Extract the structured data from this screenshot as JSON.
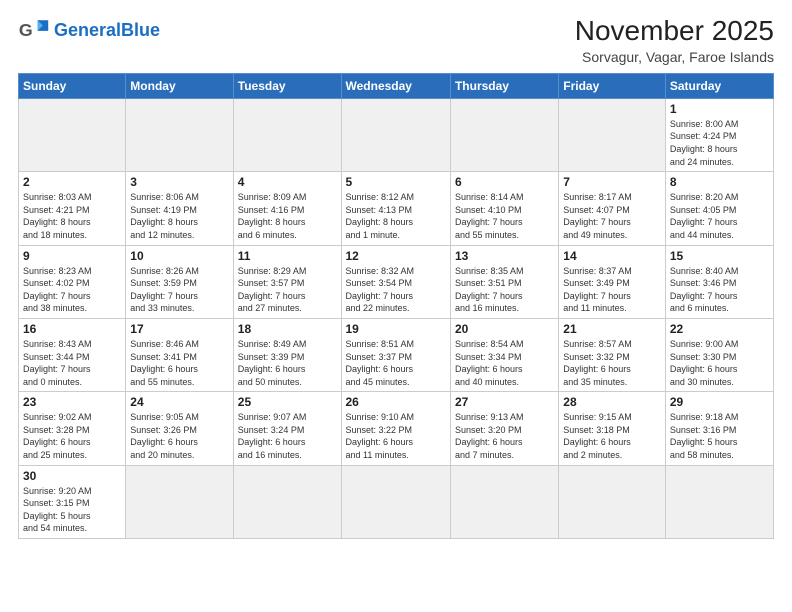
{
  "header": {
    "logo_general": "General",
    "logo_blue": "Blue",
    "month": "November 2025",
    "location": "Sorvagur, Vagar, Faroe Islands"
  },
  "weekdays": [
    "Sunday",
    "Monday",
    "Tuesday",
    "Wednesday",
    "Thursday",
    "Friday",
    "Saturday"
  ],
  "weeks": [
    [
      {
        "day": "",
        "info": "",
        "empty": true
      },
      {
        "day": "",
        "info": "",
        "empty": true
      },
      {
        "day": "",
        "info": "",
        "empty": true
      },
      {
        "day": "",
        "info": "",
        "empty": true
      },
      {
        "day": "",
        "info": "",
        "empty": true
      },
      {
        "day": "",
        "info": "",
        "empty": true
      },
      {
        "day": "1",
        "info": "Sunrise: 8:00 AM\nSunset: 4:24 PM\nDaylight: 8 hours\nand 24 minutes."
      }
    ],
    [
      {
        "day": "2",
        "info": "Sunrise: 8:03 AM\nSunset: 4:21 PM\nDaylight: 8 hours\nand 18 minutes."
      },
      {
        "day": "3",
        "info": "Sunrise: 8:06 AM\nSunset: 4:19 PM\nDaylight: 8 hours\nand 12 minutes."
      },
      {
        "day": "4",
        "info": "Sunrise: 8:09 AM\nSunset: 4:16 PM\nDaylight: 8 hours\nand 6 minutes."
      },
      {
        "day": "5",
        "info": "Sunrise: 8:12 AM\nSunset: 4:13 PM\nDaylight: 8 hours\nand 1 minute."
      },
      {
        "day": "6",
        "info": "Sunrise: 8:14 AM\nSunset: 4:10 PM\nDaylight: 7 hours\nand 55 minutes."
      },
      {
        "day": "7",
        "info": "Sunrise: 8:17 AM\nSunset: 4:07 PM\nDaylight: 7 hours\nand 49 minutes."
      },
      {
        "day": "8",
        "info": "Sunrise: 8:20 AM\nSunset: 4:05 PM\nDaylight: 7 hours\nand 44 minutes."
      }
    ],
    [
      {
        "day": "9",
        "info": "Sunrise: 8:23 AM\nSunset: 4:02 PM\nDaylight: 7 hours\nand 38 minutes."
      },
      {
        "day": "10",
        "info": "Sunrise: 8:26 AM\nSunset: 3:59 PM\nDaylight: 7 hours\nand 33 minutes."
      },
      {
        "day": "11",
        "info": "Sunrise: 8:29 AM\nSunset: 3:57 PM\nDaylight: 7 hours\nand 27 minutes."
      },
      {
        "day": "12",
        "info": "Sunrise: 8:32 AM\nSunset: 3:54 PM\nDaylight: 7 hours\nand 22 minutes."
      },
      {
        "day": "13",
        "info": "Sunrise: 8:35 AM\nSunset: 3:51 PM\nDaylight: 7 hours\nand 16 minutes."
      },
      {
        "day": "14",
        "info": "Sunrise: 8:37 AM\nSunset: 3:49 PM\nDaylight: 7 hours\nand 11 minutes."
      },
      {
        "day": "15",
        "info": "Sunrise: 8:40 AM\nSunset: 3:46 PM\nDaylight: 7 hours\nand 6 minutes."
      }
    ],
    [
      {
        "day": "16",
        "info": "Sunrise: 8:43 AM\nSunset: 3:44 PM\nDaylight: 7 hours\nand 0 minutes."
      },
      {
        "day": "17",
        "info": "Sunrise: 8:46 AM\nSunset: 3:41 PM\nDaylight: 6 hours\nand 55 minutes."
      },
      {
        "day": "18",
        "info": "Sunrise: 8:49 AM\nSunset: 3:39 PM\nDaylight: 6 hours\nand 50 minutes."
      },
      {
        "day": "19",
        "info": "Sunrise: 8:51 AM\nSunset: 3:37 PM\nDaylight: 6 hours\nand 45 minutes."
      },
      {
        "day": "20",
        "info": "Sunrise: 8:54 AM\nSunset: 3:34 PM\nDaylight: 6 hours\nand 40 minutes."
      },
      {
        "day": "21",
        "info": "Sunrise: 8:57 AM\nSunset: 3:32 PM\nDaylight: 6 hours\nand 35 minutes."
      },
      {
        "day": "22",
        "info": "Sunrise: 9:00 AM\nSunset: 3:30 PM\nDaylight: 6 hours\nand 30 minutes."
      }
    ],
    [
      {
        "day": "23",
        "info": "Sunrise: 9:02 AM\nSunset: 3:28 PM\nDaylight: 6 hours\nand 25 minutes."
      },
      {
        "day": "24",
        "info": "Sunrise: 9:05 AM\nSunset: 3:26 PM\nDaylight: 6 hours\nand 20 minutes."
      },
      {
        "day": "25",
        "info": "Sunrise: 9:07 AM\nSunset: 3:24 PM\nDaylight: 6 hours\nand 16 minutes."
      },
      {
        "day": "26",
        "info": "Sunrise: 9:10 AM\nSunset: 3:22 PM\nDaylight: 6 hours\nand 11 minutes."
      },
      {
        "day": "27",
        "info": "Sunrise: 9:13 AM\nSunset: 3:20 PM\nDaylight: 6 hours\nand 7 minutes."
      },
      {
        "day": "28",
        "info": "Sunrise: 9:15 AM\nSunset: 3:18 PM\nDaylight: 6 hours\nand 2 minutes."
      },
      {
        "day": "29",
        "info": "Sunrise: 9:18 AM\nSunset: 3:16 PM\nDaylight: 5 hours\nand 58 minutes."
      }
    ],
    [
      {
        "day": "30",
        "info": "Sunrise: 9:20 AM\nSunset: 3:15 PM\nDaylight: 5 hours\nand 54 minutes."
      },
      {
        "day": "",
        "info": "",
        "empty": true
      },
      {
        "day": "",
        "info": "",
        "empty": true
      },
      {
        "day": "",
        "info": "",
        "empty": true
      },
      {
        "day": "",
        "info": "",
        "empty": true
      },
      {
        "day": "",
        "info": "",
        "empty": true
      },
      {
        "day": "",
        "info": "",
        "empty": true
      }
    ]
  ]
}
